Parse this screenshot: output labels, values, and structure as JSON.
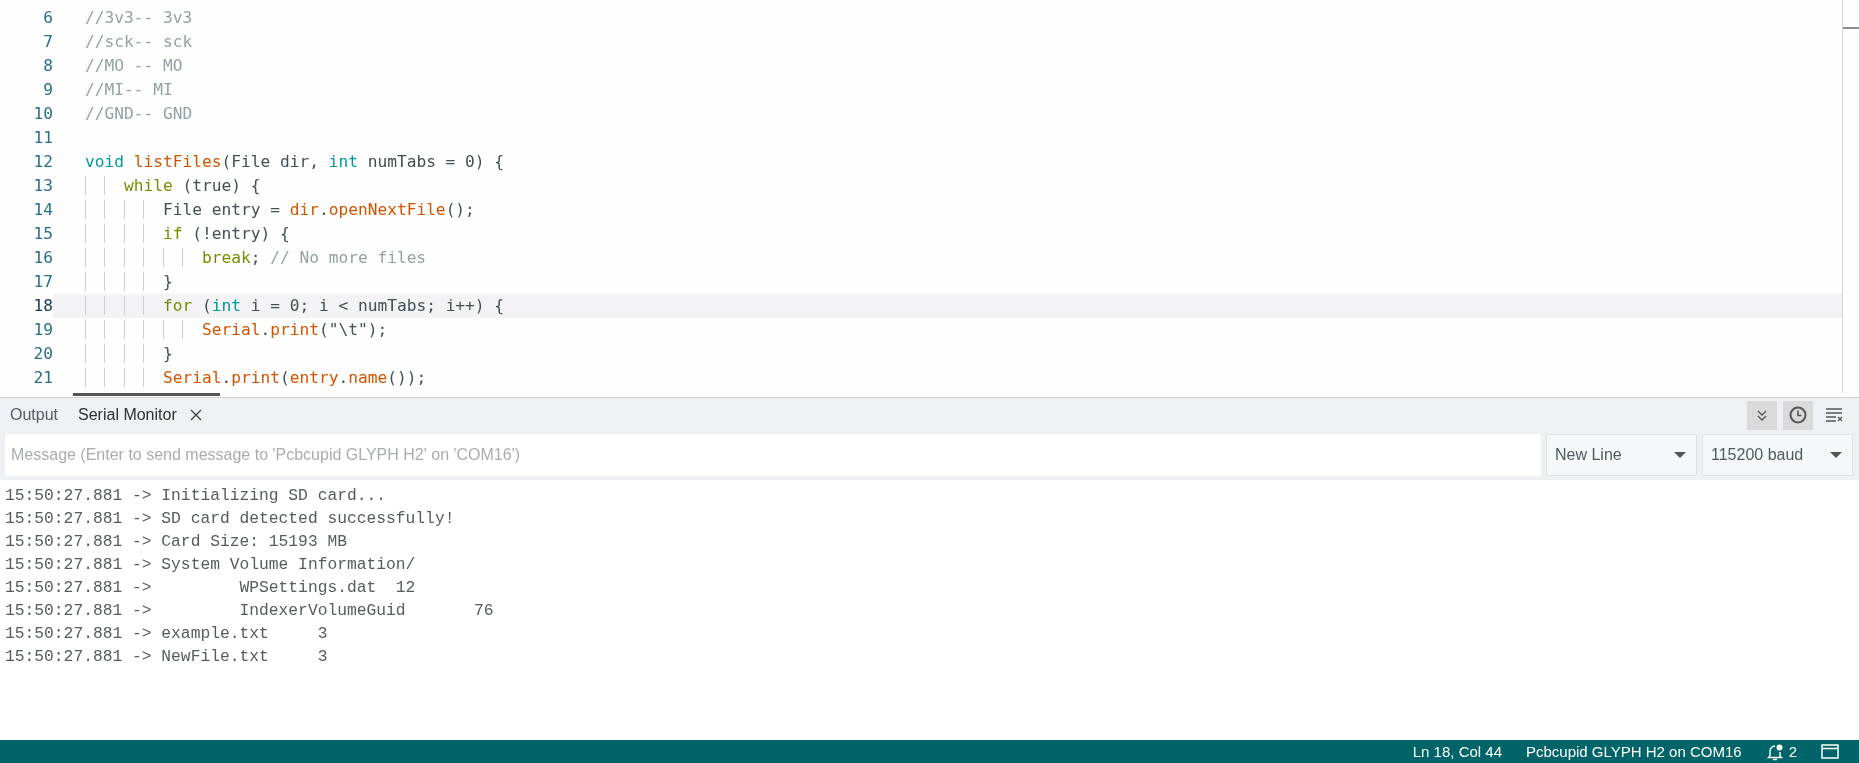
{
  "editor": {
    "lines": [
      {
        "number": "6",
        "current": false,
        "tokens": [
          {
            "kind": "comment",
            "text": "//3v3-- 3v3"
          }
        ]
      },
      {
        "number": "7",
        "current": false,
        "tokens": [
          {
            "kind": "comment",
            "text": "//sck-- sck"
          }
        ]
      },
      {
        "number": "8",
        "current": false,
        "tokens": [
          {
            "kind": "comment",
            "text": "//MO -- MO"
          }
        ]
      },
      {
        "number": "9",
        "current": false,
        "tokens": [
          {
            "kind": "comment",
            "text": "//MI-- MI"
          }
        ]
      },
      {
        "number": "10",
        "current": false,
        "tokens": [
          {
            "kind": "comment",
            "text": "//GND-- GND"
          }
        ]
      },
      {
        "number": "11",
        "current": false
      },
      {
        "number": "12",
        "current": false,
        "tokens": [
          {
            "kind": "type",
            "text": "void"
          },
          {
            "kind": "func",
            "text": " listFiles"
          },
          {
            "kind": "plain",
            "text": "(File dir, "
          },
          {
            "kind": "type",
            "text": "int"
          },
          {
            "kind": "plain",
            "text": " numTabs = 0) {"
          }
        ]
      },
      {
        "number": "13",
        "current": false,
        "tokens": [
          {
            "kind": "keyword",
            "text": "    while"
          },
          {
            "kind": "plain",
            "text": " (true) {"
          }
        ]
      },
      {
        "number": "14",
        "current": false,
        "tokens": [
          {
            "kind": "plain",
            "text": "        File entry = "
          },
          {
            "kind": "func",
            "text": "dir"
          },
          {
            "kind": "plain",
            "text": "."
          },
          {
            "kind": "func",
            "text": "openNextFile"
          },
          {
            "kind": "plain",
            "text": "();"
          }
        ]
      },
      {
        "number": "15",
        "current": false,
        "tokens": [
          {
            "kind": "keyword",
            "text": "        if"
          },
          {
            "kind": "plain",
            "text": " (!entry) {"
          }
        ]
      },
      {
        "number": "16",
        "current": false,
        "tokens": [
          {
            "kind": "keyword",
            "text": "            break"
          },
          {
            "kind": "plain",
            "text": "; "
          },
          {
            "kind": "comment",
            "text": "// No more files"
          }
        ]
      },
      {
        "number": "17",
        "current": false,
        "tokens": [
          {
            "kind": "plain",
            "text": "        }"
          }
        ]
      },
      {
        "number": "18",
        "current": true,
        "tokens": [
          {
            "kind": "keyword",
            "text": "        for"
          },
          {
            "kind": "plain",
            "text": " ("
          },
          {
            "kind": "type",
            "text": "int"
          },
          {
            "kind": "plain",
            "text": " i = 0; i < numTabs; i++) {"
          }
        ]
      },
      {
        "number": "19",
        "current": false,
        "tokens": [
          {
            "kind": "func",
            "text": "            Serial"
          },
          {
            "kind": "plain",
            "text": "."
          },
          {
            "kind": "func",
            "text": "print"
          },
          {
            "kind": "plain",
            "text": "(\"\\t\");"
          }
        ]
      },
      {
        "number": "20",
        "current": false,
        "tokens": [
          {
            "kind": "plain",
            "text": "        }"
          }
        ]
      },
      {
        "number": "21",
        "current": false,
        "tokens": [
          {
            "kind": "func",
            "text": "        Serial"
          },
          {
            "kind": "plain",
            "text": "."
          },
          {
            "kind": "func",
            "text": "print"
          },
          {
            "kind": "plain",
            "text": "("
          },
          {
            "kind": "func",
            "text": "entry"
          },
          {
            "kind": "plain",
            "text": "."
          },
          {
            "kind": "func",
            "text": "name"
          },
          {
            "kind": "plain",
            "text": "());"
          }
        ]
      }
    ]
  },
  "panel": {
    "tabs": [
      {
        "label": "Output",
        "selected": false
      },
      {
        "label": "Serial Monitor",
        "selected": true
      }
    ],
    "toolbar": [
      {
        "kind": "autoscroll",
        "on": true
      },
      {
        "kind": "timestamp",
        "on": true
      },
      {
        "kind": "clear"
      }
    ],
    "message": {
      "placeholder": "Message (Enter to send message to 'Pcbcupid GLYPH H2' on 'COM16')"
    },
    "line_ending": {
      "value": "New Line"
    },
    "baud_rate": {
      "value": "115200 baud"
    },
    "output": [
      "15:50:27.881 -> Initializing SD card...",
      "15:50:27.881 -> SD card detected successfully!",
      "15:50:27.881 -> Card Size: 15193 MB",
      "15:50:27.881 -> System Volume Information/",
      "15:50:27.881 ->         WPSettings.dat  12",
      "15:50:27.881 ->         IndexerVolumeGuid       76",
      "15:50:27.881 -> example.txt     3",
      "15:50:27.881 -> NewFile.txt     3"
    ]
  },
  "status_bar": {
    "position": "Ln 18, Col 44",
    "board": "Pcbcupid GLYPH H2 on COM16",
    "notifications": "2"
  }
}
